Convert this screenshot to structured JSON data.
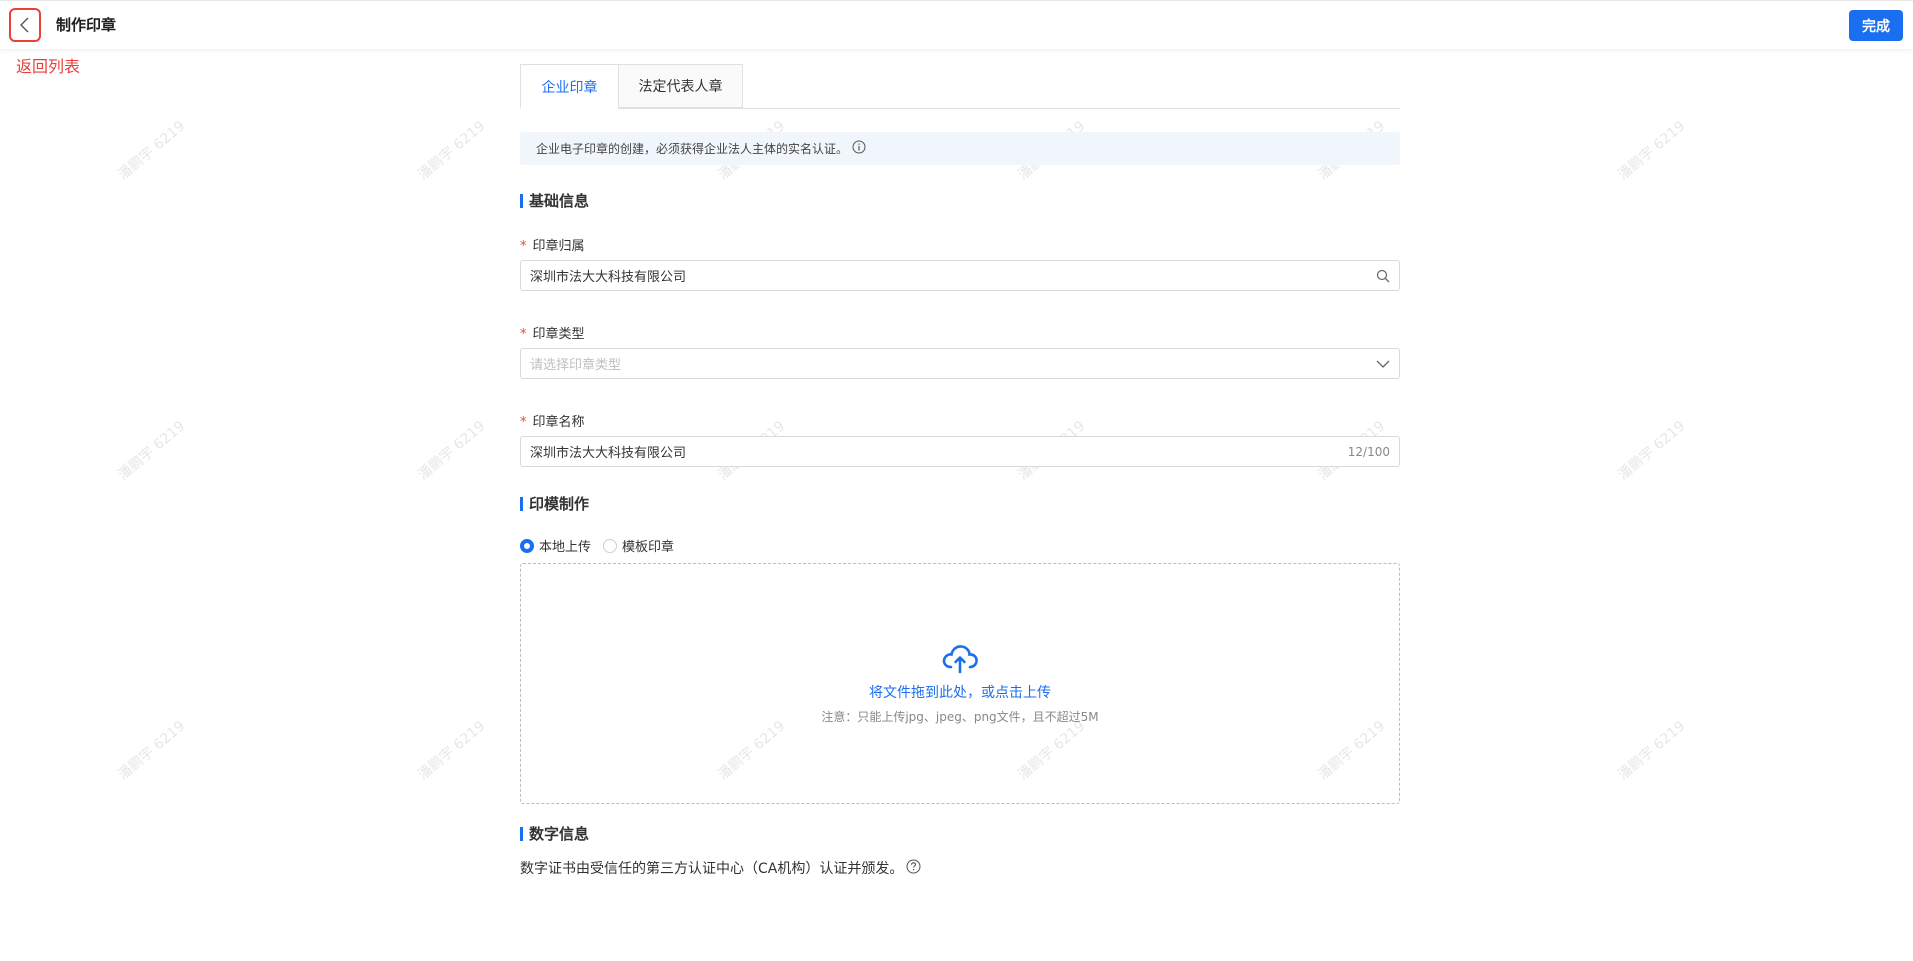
{
  "header": {
    "title": "制作印章",
    "done_label": "完成",
    "back_annotation": "返回列表"
  },
  "watermark": "潘鹏宇 6219",
  "tabs": [
    {
      "label": "企业印章",
      "active": true
    },
    {
      "label": "法定代表人章",
      "active": false
    }
  ],
  "notice": "企业电子印章的创建，必须获得企业法人主体的实名认证。",
  "sections": {
    "basic": "基础信息",
    "mold": "印模制作",
    "digital": "数字信息"
  },
  "form": {
    "owner_label": "印章归属",
    "owner_value": "深圳市法大大科技有限公司",
    "type_label": "印章类型",
    "type_placeholder": "请选择印章类型",
    "name_label": "印章名称",
    "name_value": "深圳市法大大科技有限公司",
    "name_count": "12/100",
    "required_mark": "*"
  },
  "mold": {
    "options": [
      "本地上传",
      "模板印章"
    ],
    "selected": "本地上传",
    "upload_main": "将文件拖到此处，或点击上传",
    "upload_hint": "注意：只能上传jpg、jpeg、png文件，且不超过5M"
  },
  "digital_text": "数字证书由受信任的第三方认证中心（CA机构）认证并颁发。",
  "colors": {
    "primary": "#1a6ff0",
    "danger": "#e8413c"
  }
}
